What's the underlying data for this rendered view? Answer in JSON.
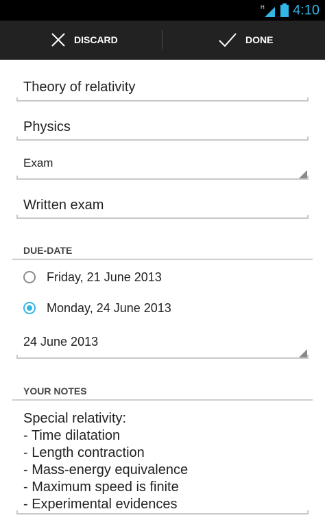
{
  "status": {
    "time": "4:10",
    "network": "H"
  },
  "actionbar": {
    "discard_label": "DISCARD",
    "done_label": "DONE"
  },
  "form": {
    "title_value": "Theory of relativity",
    "subject_value": "Physics",
    "type_selected": "Exam",
    "description_value": "Written exam"
  },
  "due_date": {
    "header": "DUE-DATE",
    "options": [
      {
        "label": "Friday, 21 June 2013",
        "checked": false
      },
      {
        "label": "Monday, 24 June 2013",
        "checked": true
      }
    ],
    "picker_value": "24 June 2013"
  },
  "notes": {
    "header": "YOUR NOTES",
    "value": "Special relativity:\n- Time dilatation\n- Length contraction\n- Mass-energy equivalence\n- Maximum speed is finite\n- Experimental evidences"
  },
  "colors": {
    "accent": "#33b5e5",
    "actionbar": "#222222"
  }
}
